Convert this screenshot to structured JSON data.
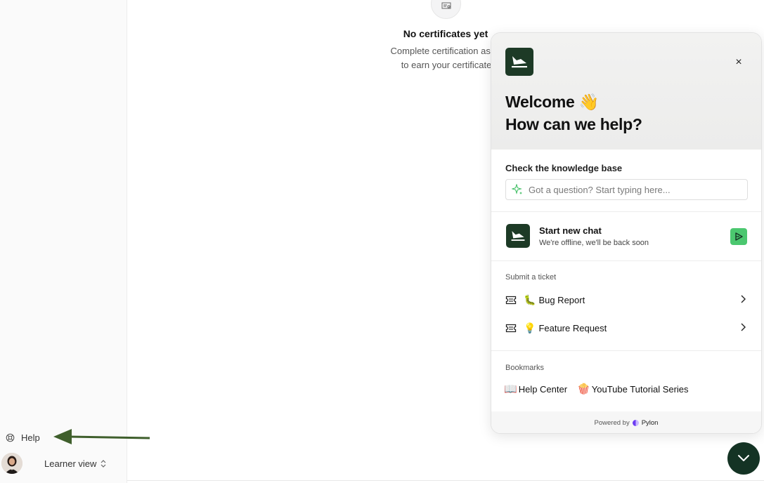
{
  "sidebar": {
    "help_label": "Help",
    "learner_view_label": "Learner view"
  },
  "main": {
    "empty_title": "No certificates yet",
    "empty_subtitle_line1": "Complete certification assig",
    "empty_subtitle_line2": "to earn your certificate"
  },
  "widget": {
    "welcome_line1": "Welcome 👋",
    "welcome_line2": "How can we help?",
    "close_icon": "×",
    "knowledge_base": {
      "title": "Check the knowledge base",
      "placeholder": "Got a question? Start typing here..."
    },
    "chat": {
      "title": "Start new chat",
      "subtitle": "We're offline, we'll be back soon"
    },
    "tickets": {
      "label": "Submit a ticket",
      "items": [
        {
          "emoji": "🐛",
          "label": "Bug Report"
        },
        {
          "emoji": "💡",
          "label": "Feature Request"
        }
      ]
    },
    "bookmarks": {
      "label": "Bookmarks",
      "items": [
        {
          "emoji": "📖",
          "label": "Help Center"
        },
        {
          "emoji": "🍿",
          "label": "YouTube Tutorial Series"
        }
      ]
    },
    "powered_by": "Powered by",
    "brand": "Pylon"
  },
  "colors": {
    "brand_dark_green": "#1d3a26",
    "send_green": "#4bc76f",
    "annotation_arrow": "#3f5f2c"
  }
}
